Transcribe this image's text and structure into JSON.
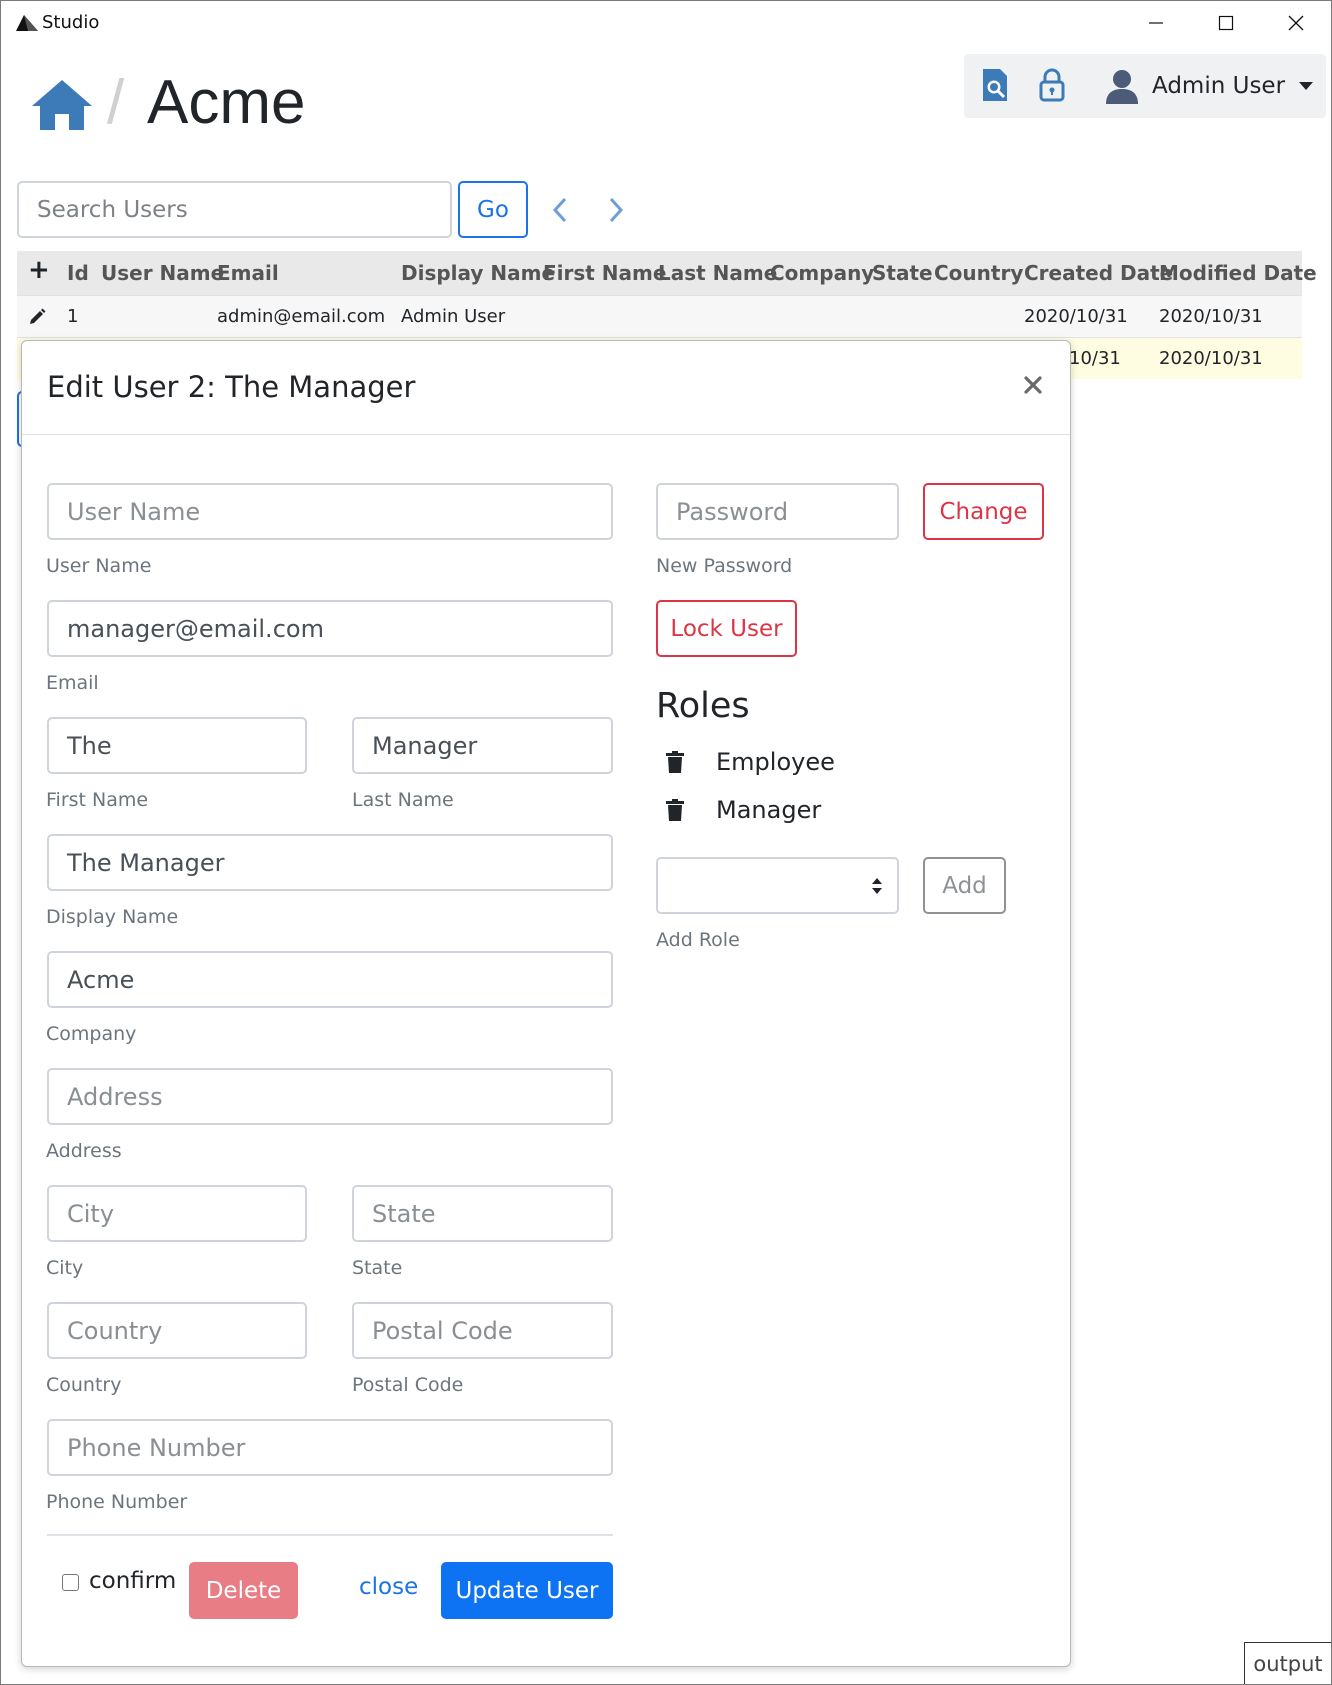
{
  "window": {
    "title": "Studio"
  },
  "header": {
    "breadcrumb_separator": "/",
    "title": "Acme"
  },
  "topbar": {
    "user_name": "Admin User"
  },
  "search": {
    "placeholder": "Search Users",
    "value": "",
    "go_label": "Go"
  },
  "table": {
    "add_symbol": "+",
    "columns": [
      "Id",
      "User Name",
      "Email",
      "Display Name",
      "First Name",
      "Last Name",
      "Company",
      "State",
      "Country",
      "Created Date",
      "Modified Date"
    ],
    "rows": [
      {
        "id": "1",
        "email": "admin@email.com",
        "display_name": "Admin User",
        "created": "2020/10/31",
        "modified": "2020/10/31"
      },
      {
        "created_partial": "10/31",
        "modified": "2020/10/31"
      }
    ]
  },
  "modal": {
    "title": "Edit User 2: The Manager",
    "fields": {
      "user_name": {
        "value": "",
        "placeholder": "User Name",
        "label": "User Name"
      },
      "email": {
        "value": "manager@email.com",
        "placeholder": "Email",
        "label": "Email"
      },
      "first_name": {
        "value": "The",
        "placeholder": "First Name",
        "label": "First Name"
      },
      "last_name": {
        "value": "Manager",
        "placeholder": "Last Name",
        "label": "Last Name"
      },
      "display_name": {
        "value": "The Manager",
        "placeholder": "Display Name",
        "label": "Display Name"
      },
      "company": {
        "value": "Acme",
        "placeholder": "Company",
        "label": "Company"
      },
      "address": {
        "value": "",
        "placeholder": "Address",
        "label": "Address"
      },
      "city": {
        "value": "",
        "placeholder": "City",
        "label": "City"
      },
      "state": {
        "value": "",
        "placeholder": "State",
        "label": "State"
      },
      "country": {
        "value": "",
        "placeholder": "Country",
        "label": "Country"
      },
      "postal_code": {
        "value": "",
        "placeholder": "Postal Code",
        "label": "Postal Code"
      },
      "phone": {
        "value": "",
        "placeholder": "Phone Number",
        "label": "Phone Number"
      },
      "password": {
        "value": "",
        "placeholder": "Password",
        "label": "New Password"
      }
    },
    "change_label": "Change",
    "lock_label": "Lock User",
    "roles_title": "Roles",
    "roles": [
      "Employee",
      "Manager"
    ],
    "add_role_label": "Add Role",
    "add_label": "Add",
    "confirm_label": "confirm",
    "delete_label": "Delete",
    "close_label": "close",
    "update_label": "Update User"
  },
  "output_label": "output",
  "colors": {
    "primary": "#0d73f2",
    "danger": "#dc3545",
    "icon_blue": "#3d7ab8",
    "row_highlight": "#fffde1"
  }
}
